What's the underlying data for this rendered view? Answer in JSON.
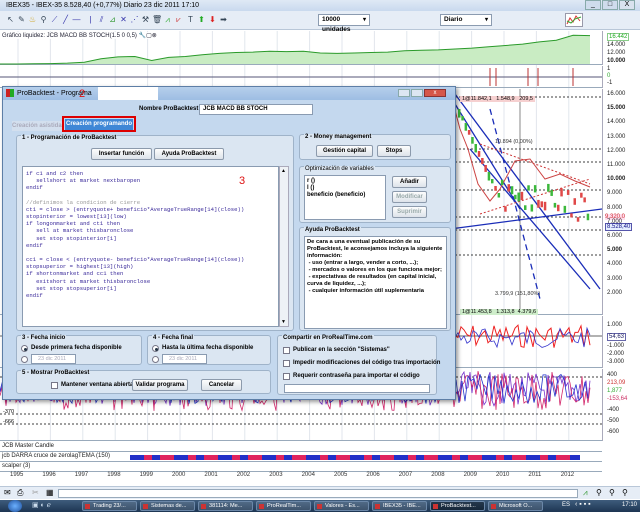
{
  "window": {
    "title": "IBEX35 - IBEX-35   8.528,40 (+0,77%)   Diario  23 dic 2011 17:10",
    "minimize": "_",
    "maximize": "□",
    "close": "X"
  },
  "toolbar": {
    "units": "10000 unidades",
    "period": "Diario"
  },
  "equity_pane": {
    "title": "Gráfico liquidez: JCB MACD BB STOCH(1.5 0 0,5)",
    "last_value": "16.442",
    "axis": [
      "14.000",
      "12.000",
      "10.000"
    ],
    "series": [
      10000,
      10000,
      10050,
      10100,
      10200,
      10400,
      11200,
      11600,
      11700,
      10800,
      11500,
      11700,
      12100,
      12400,
      12600,
      12700,
      12900,
      12800,
      12900,
      12500,
      12400,
      12500,
      12600,
      12700,
      13000,
      13100,
      13200,
      13400,
      13600,
      13900,
      14200,
      14500,
      15000,
      15400,
      16500,
      16442
    ]
  },
  "signal_pane": {
    "axis": [
      "1",
      "0",
      "-1"
    ]
  },
  "price_pane": {
    "axis": [
      "16.000",
      "15.000",
      "14.000",
      "13.000",
      "12.000",
      "11.000",
      "10.000",
      "9.000",
      "8.000",
      "7.000",
      "6.000",
      "5.000",
      "4.000",
      "3.000",
      "2.000"
    ],
    "current_price": "8.528,40",
    "level_tag": "9.320,0",
    "annotations": [
      "1@11.842,1",
      "1.548,9",
      "209,5",
      "10.894 (0,00%)",
      "3.799,9 (151,80%)",
      "1@11.453,8",
      "1.313,8",
      "4.379,6"
    ]
  },
  "macd_pane": {
    "axis": [
      "1.000",
      "-1.000",
      "-2.000",
      "-3.000"
    ],
    "last_value": "54,63"
  },
  "stoch_pane": {
    "axis": [
      "400",
      "-400",
      "-500",
      "-600"
    ],
    "tags": [
      "213,09",
      "1,877",
      "-153,64"
    ],
    "levels": [
      "-370",
      "-666"
    ]
  },
  "indicator_rows": [
    "JCB Master Candle",
    "jcb DARRA cruce de zerolagTEMA (150)",
    "scalper (3)"
  ],
  "years": [
    "1995",
    "1996",
    "1997",
    "1998",
    "1999",
    "2000",
    "2001",
    "2002",
    "2003",
    "2004",
    "2005",
    "2006",
    "2007",
    "2008",
    "2009",
    "2010",
    "2011",
    "2012"
  ],
  "dialog": {
    "title": "ProBacktest - Programa",
    "annotation_2": "2",
    "annotation_3": "3",
    "name_label": "Nombre ProBacktest",
    "name_value": "JCB MACD BB STOCH",
    "tabs": [
      {
        "label": "Creación asistida",
        "active": false
      },
      {
        "label": "Creación programando",
        "active": true
      }
    ],
    "section1": {
      "title": "1 - Programación de ProBacktest",
      "insert_btn": "Insertar función",
      "help_btn": "Ayuda ProBacktest"
    },
    "code": [
      "if c1 and c2 then",
      "   sellshort at market nextbaropen",
      "endif",
      "",
      "//definimos la condicion de cierre",
      "ct1 = close > (entryquote+ beneficio*AverageTrueRange[14](close))",
      "stopinterior = lowest[13](low)",
      "if longonmarket and ct1 then",
      "   sell at market thisbaronclose",
      "   set stop stopinterior[1]",
      "endif",
      "",
      "cc1 = close < (entryquote- beneficio*AverageTrueRange[14](close))",
      "stopsuperior = highest[13](high)",
      "if shortonmarket and cc1 then",
      "   exitshort at market thisbaronclose",
      "   set stop stopsuperior[1]",
      "endif"
    ],
    "section2": {
      "title": "2 - Money management",
      "capital_btn": "Gestión capital",
      "stops_btn": "Stops"
    },
    "optim": {
      "title": "Optimización de variables",
      "vars": [
        "r ()",
        "l ()",
        "beneficio (beneficio)"
      ],
      "add": "Añadir",
      "modify": "Modificar",
      "delete": "Suprimir"
    },
    "help": {
      "title": "Ayuda ProBacktest",
      "text": "De cara a una eventual publicación de su ProBacktest, le aconsejamos incluya la siguiente información:\n - uso (entrar a largo, vender a corto, ...);\n - mercados o valores en los que funciona mejor;\n - expectativas de resultados (en capital inicial, curva de liquidez, ...);\n - cualquier información útil suplementaria"
    },
    "section3": {
      "title": "3 - Fecha inicio",
      "option": "Desde primera fecha disponible",
      "date": "23 dic 2011"
    },
    "section4": {
      "title": "4 - Fecha final",
      "option": "Hasta la última fecha disponible",
      "date": "23 dic 2011"
    },
    "section5": {
      "title": "5 - Mostrar ProBacktest",
      "keep_open": "Mantener ventana abierta",
      "validate": "Validar programa",
      "cancel": "Cancelar"
    },
    "share": {
      "title": "Compartir en ProRealTime.com",
      "publish": "Publicar en la sección \"Sistemas\"",
      "prevent": "Impedir modificaciones del código tras importación",
      "password": "Requerir contraseña para importar el código"
    }
  },
  "taskbar": {
    "items": [
      "Trading 23/...",
      "Sistemas de...",
      "381114: Me...",
      "ProRealTim...",
      "Valores - Es...",
      "IBEX35 - IBE...",
      "ProBacktest...",
      "Microsoft O..."
    ],
    "lang": "ES",
    "time": "17:10"
  }
}
